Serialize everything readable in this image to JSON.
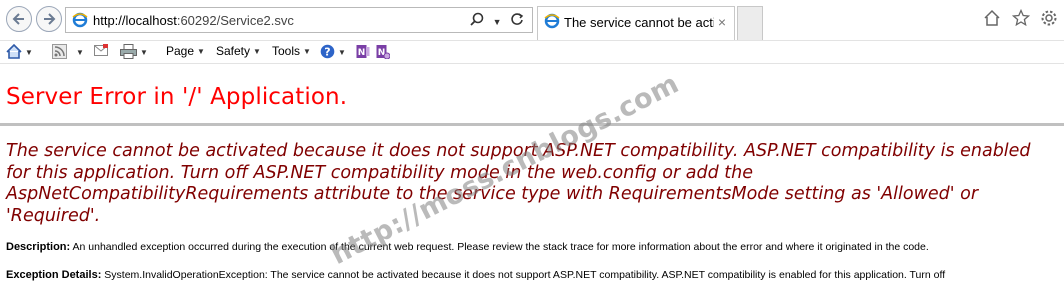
{
  "browser": {
    "url_host": "http://localhost",
    "url_rest": ":60292/Service2.svc",
    "tab_title": "The service cannot be activ...",
    "tab_close": "×"
  },
  "commandbar": {
    "page_label": "Page",
    "safety_label": "Safety",
    "tools_label": "Tools"
  },
  "page": {
    "heading": "Server Error in '/' Application.",
    "message": "The service cannot be activated because it does not support ASP.NET compatibility. ASP.NET compatibility is enabled for this application. Turn off ASP.NET compatibility mode in the web.config or add the AspNetCompatibilityRequirements attribute to the service type with RequirementsMode setting as 'Allowed' or 'Required'.",
    "description_label": "Description:",
    "description_text": "An unhandled exception occurred during the execution of the current web request. Please review the stack trace for more information about the error and where it originated in the code.",
    "exception_label": "Exception Details:",
    "exception_text": "System.InvalidOperationException: The service cannot be activated because it does not support ASP.NET compatibility. ASP.NET compatibility is enabled for this application. Turn off"
  },
  "watermark": "http://moss.cnblogs.com",
  "colors": {
    "heading": "#ff0000",
    "message": "#800000",
    "rule": "#c0c0c0"
  }
}
